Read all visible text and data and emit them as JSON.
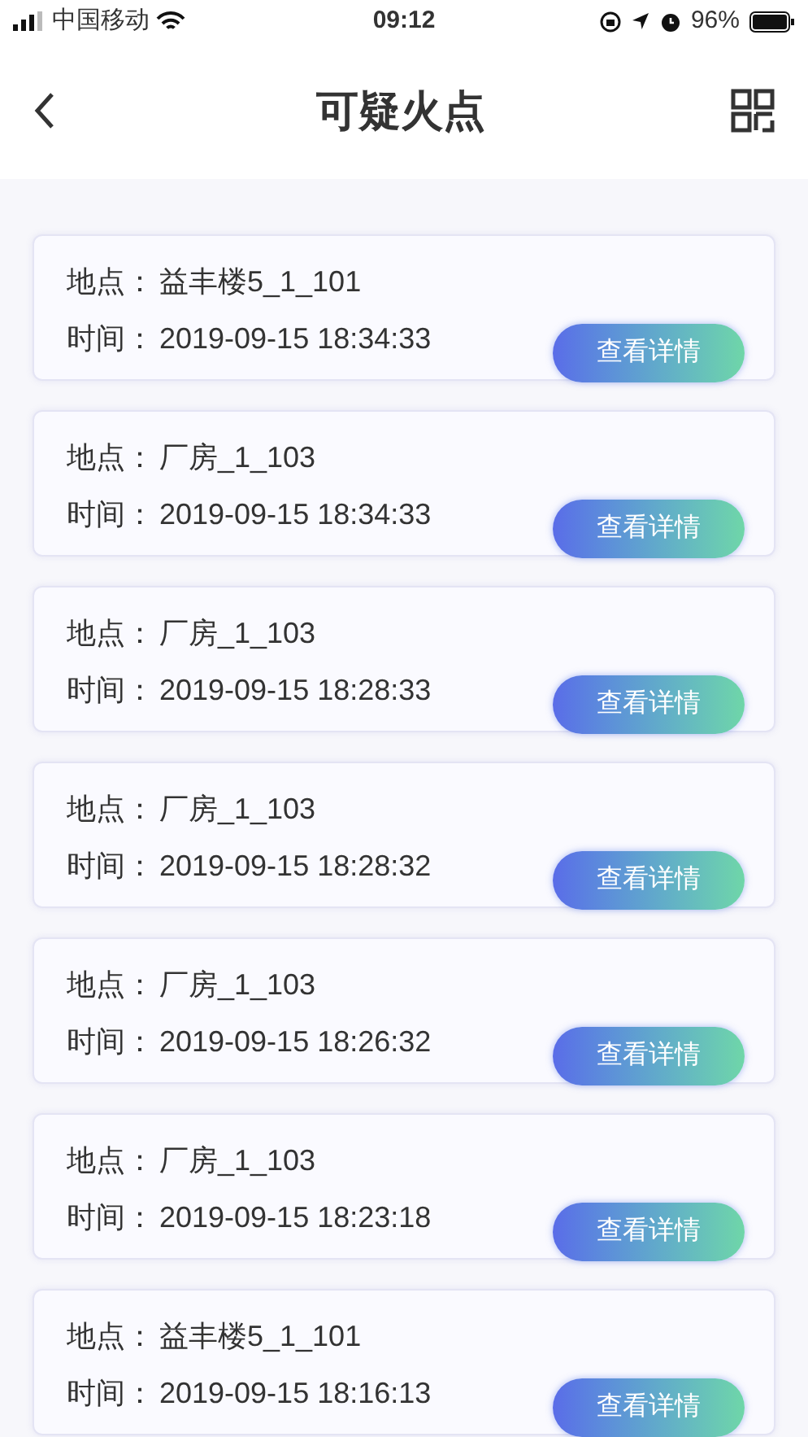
{
  "status_bar": {
    "carrier": "中国移动",
    "time": "09:12",
    "battery": "96%"
  },
  "nav": {
    "title": "可疑火点"
  },
  "records": [
    {
      "place_label": "地点：",
      "place": "益丰楼5_1_101",
      "time_label": "时间：",
      "time": "2019-09-15 18:34:33",
      "button": "查看详情"
    },
    {
      "place_label": "地点：",
      "place": "厂房_1_103",
      "time_label": "时间：",
      "time": "2019-09-15 18:34:33",
      "button": "查看详情"
    },
    {
      "place_label": "地点：",
      "place": "厂房_1_103",
      "time_label": "时间：",
      "time": "2019-09-15 18:28:33",
      "button": "查看详情"
    },
    {
      "place_label": "地点：",
      "place": "厂房_1_103",
      "time_label": "时间：",
      "time": "2019-09-15 18:28:32",
      "button": "查看详情"
    },
    {
      "place_label": "地点：",
      "place": "厂房_1_103",
      "time_label": "时间：",
      "time": "2019-09-15 18:26:32",
      "button": "查看详情"
    },
    {
      "place_label": "地点：",
      "place": "厂房_1_103",
      "time_label": "时间：",
      "time": "2019-09-15 18:23:18",
      "button": "查看详情"
    },
    {
      "place_label": "地点：",
      "place": "益丰楼5_1_101",
      "time_label": "时间：",
      "time": "2019-09-15 18:16:13",
      "button": "查看详情"
    }
  ]
}
